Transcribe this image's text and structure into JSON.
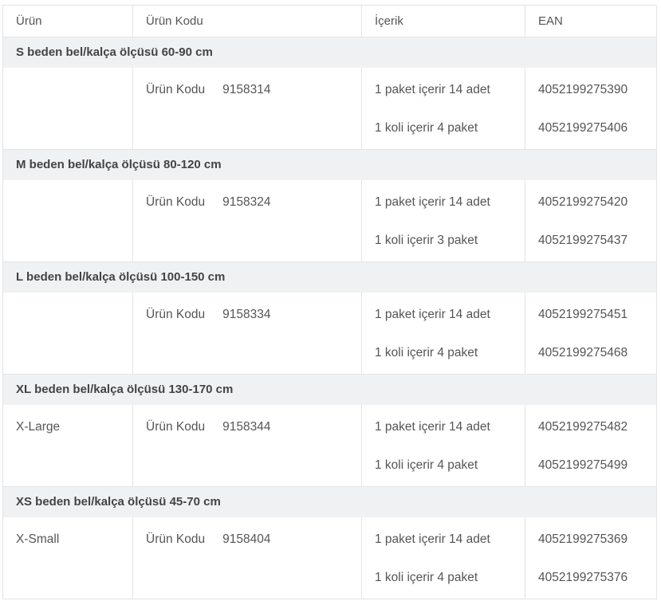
{
  "header": {
    "col_product": "Ürün",
    "col_code": "Ürün Kodu",
    "col_content": "İçerik",
    "col_ean": "EAN"
  },
  "groups": [
    {
      "title": "S beden bel/kalça ölçüsü 60-90 cm",
      "product": "",
      "code_label": "Ürün Kodu",
      "code": "9158314",
      "content1": "1 paket içerir 14 adet",
      "content2": "1 koli içerir 4 paket",
      "ean1": "4052199275390",
      "ean2": "4052199275406"
    },
    {
      "title": "M beden bel/kalça ölçüsü 80-120 cm",
      "product": "",
      "code_label": "Ürün Kodu",
      "code": "9158324",
      "content1": "1 paket içerir 14 adet",
      "content2": "1 koli içerir 3 paket",
      "ean1": "4052199275420",
      "ean2": "4052199275437"
    },
    {
      "title": "L beden bel/kalça ölçüsü 100-150 cm",
      "product": "",
      "code_label": "Ürün Kodu",
      "code": "9158334",
      "content1": "1 paket içerir 14 adet",
      "content2": "1 koli içerir 4 paket",
      "ean1": "4052199275451",
      "ean2": "4052199275468"
    },
    {
      "title": "XL beden bel/kalça ölçüsü 130-170 cm",
      "product": "X-Large",
      "code_label": "Ürün Kodu",
      "code": "9158344",
      "content1": "1 paket içerir 14 adet",
      "content2": "1 koli içerir 4 paket",
      "ean1": "4052199275482",
      "ean2": "4052199275499"
    },
    {
      "title": "XS beden bel/kalça ölçüsü 45-70 cm",
      "product": "X-Small",
      "code_label": "Ürün Kodu",
      "code": "9158404",
      "content1": "1 paket içerir 14 adet",
      "content2": "1 koli içerir 4 paket",
      "ean1": "4052199275369",
      "ean2": "4052199275376"
    }
  ]
}
